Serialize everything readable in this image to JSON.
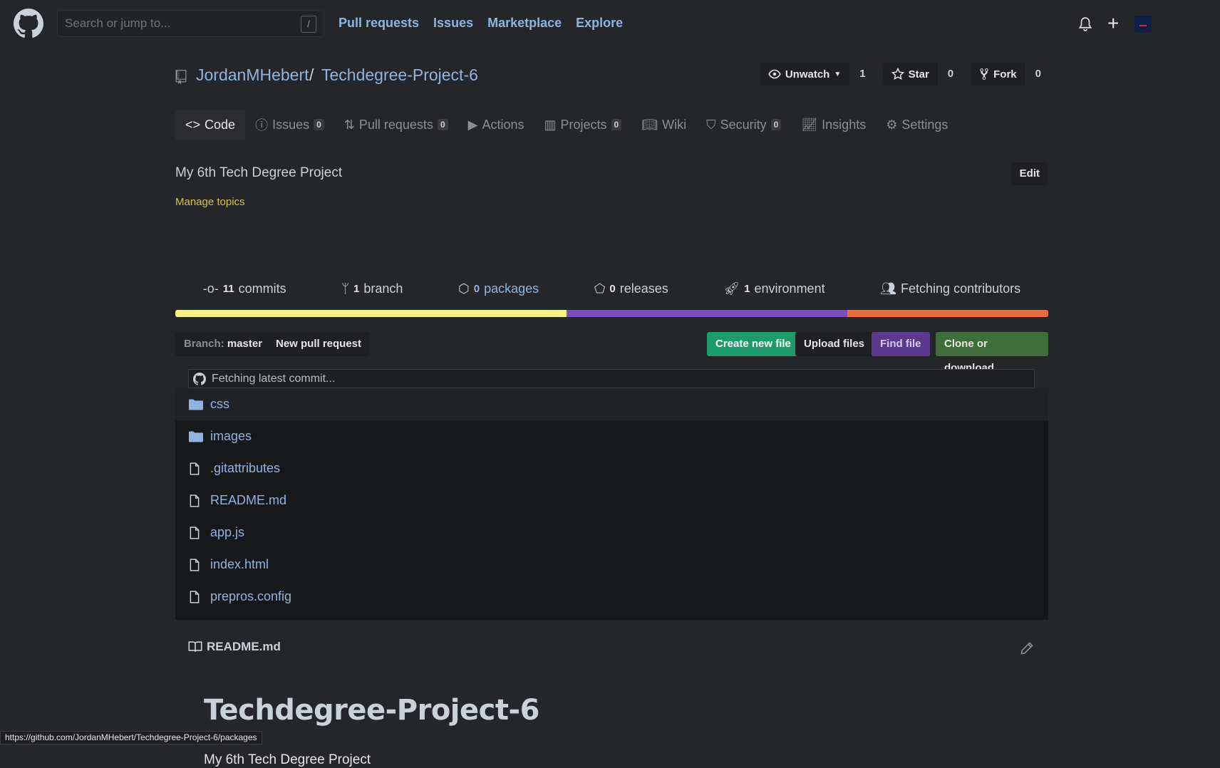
{
  "header": {
    "search_placeholder": "Search or jump to...",
    "search_key": "/",
    "nav": [
      "Pull requests",
      "Issues",
      "Marketplace",
      "Explore"
    ]
  },
  "repo": {
    "owner": "JordanMHebert",
    "separator": "/",
    "name": "Techdegree-Project-6",
    "watch_label": "Unwatch",
    "watch_count": "1",
    "star_label": "Star",
    "star_count": "0",
    "fork_label": "Fork",
    "fork_count": "0"
  },
  "tabs": [
    {
      "label": "Code",
      "count": ""
    },
    {
      "label": "Issues",
      "count": "0"
    },
    {
      "label": "Pull requests",
      "count": "0"
    },
    {
      "label": "Actions",
      "count": ""
    },
    {
      "label": "Projects",
      "count": "0"
    },
    {
      "label": "Wiki",
      "count": ""
    },
    {
      "label": "Security",
      "count": "0"
    },
    {
      "label": "Insights",
      "count": ""
    },
    {
      "label": "Settings",
      "count": ""
    }
  ],
  "about": {
    "description": "My 6th Tech Degree Project",
    "manage_topics": "Manage topics",
    "edit": "Edit"
  },
  "stats": {
    "commits_n": "11",
    "commits_l": "commits",
    "branch_n": "1",
    "branch_l": "branch",
    "packages_n": "0",
    "packages_l": "packages",
    "releases_n": "0",
    "releases_l": "releases",
    "env_n": "1",
    "env_l": "environment",
    "contributors": "Fetching contributors"
  },
  "languages": [
    {
      "color": "#f6f47e",
      "share": 44.8
    },
    {
      "color": "#7d4ec1",
      "share": 32.2
    },
    {
      "color": "#ec6b3a",
      "share": 23.0
    }
  ],
  "actions": {
    "branch_prefix": "Branch:",
    "branch": "master",
    "new_pr": "New pull request",
    "create_file": "Create new file",
    "upload": "Upload files",
    "find": "Find file",
    "clone": "Clone or download"
  },
  "commit": {
    "text": "Fetching latest commit..."
  },
  "files": [
    {
      "name": "css",
      "type": "dir"
    },
    {
      "name": "images",
      "type": "dir"
    },
    {
      "name": ".gitattributes",
      "type": "file"
    },
    {
      "name": "README.md",
      "type": "file"
    },
    {
      "name": "app.js",
      "type": "file"
    },
    {
      "name": "index.html",
      "type": "file"
    },
    {
      "name": "prepros.config",
      "type": "file"
    }
  ],
  "readme": {
    "filename": "README.md",
    "title": "Techdegree-Project-6",
    "text": "My 6th Tech Degree Project"
  },
  "status_url": "https://github.com/JordanMHebert/Techdegree-Project-6/packages",
  "colors": {
    "green": "#1d9c6b",
    "purple": "#5b3a8e",
    "clone": "#3e6f3b",
    "link": "#8fb4e0"
  }
}
